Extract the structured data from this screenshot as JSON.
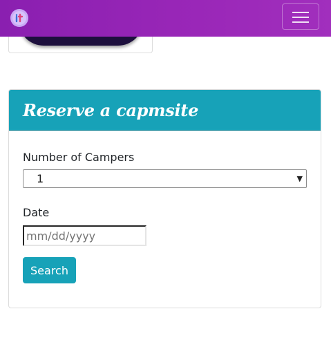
{
  "navbar": {
    "logo_icon": "brand-logo-icon",
    "toggle_icon": "hamburger-menu-icon",
    "color": "#9a27b8"
  },
  "reserve_card": {
    "title": "Reserve a capmsite",
    "header_color": "#17a2b8",
    "campers_label": "Number of Campers",
    "campers_value": "1",
    "date_label": "Date",
    "date_placeholder": "mm/dd/yyyy",
    "search_label": "Search"
  }
}
